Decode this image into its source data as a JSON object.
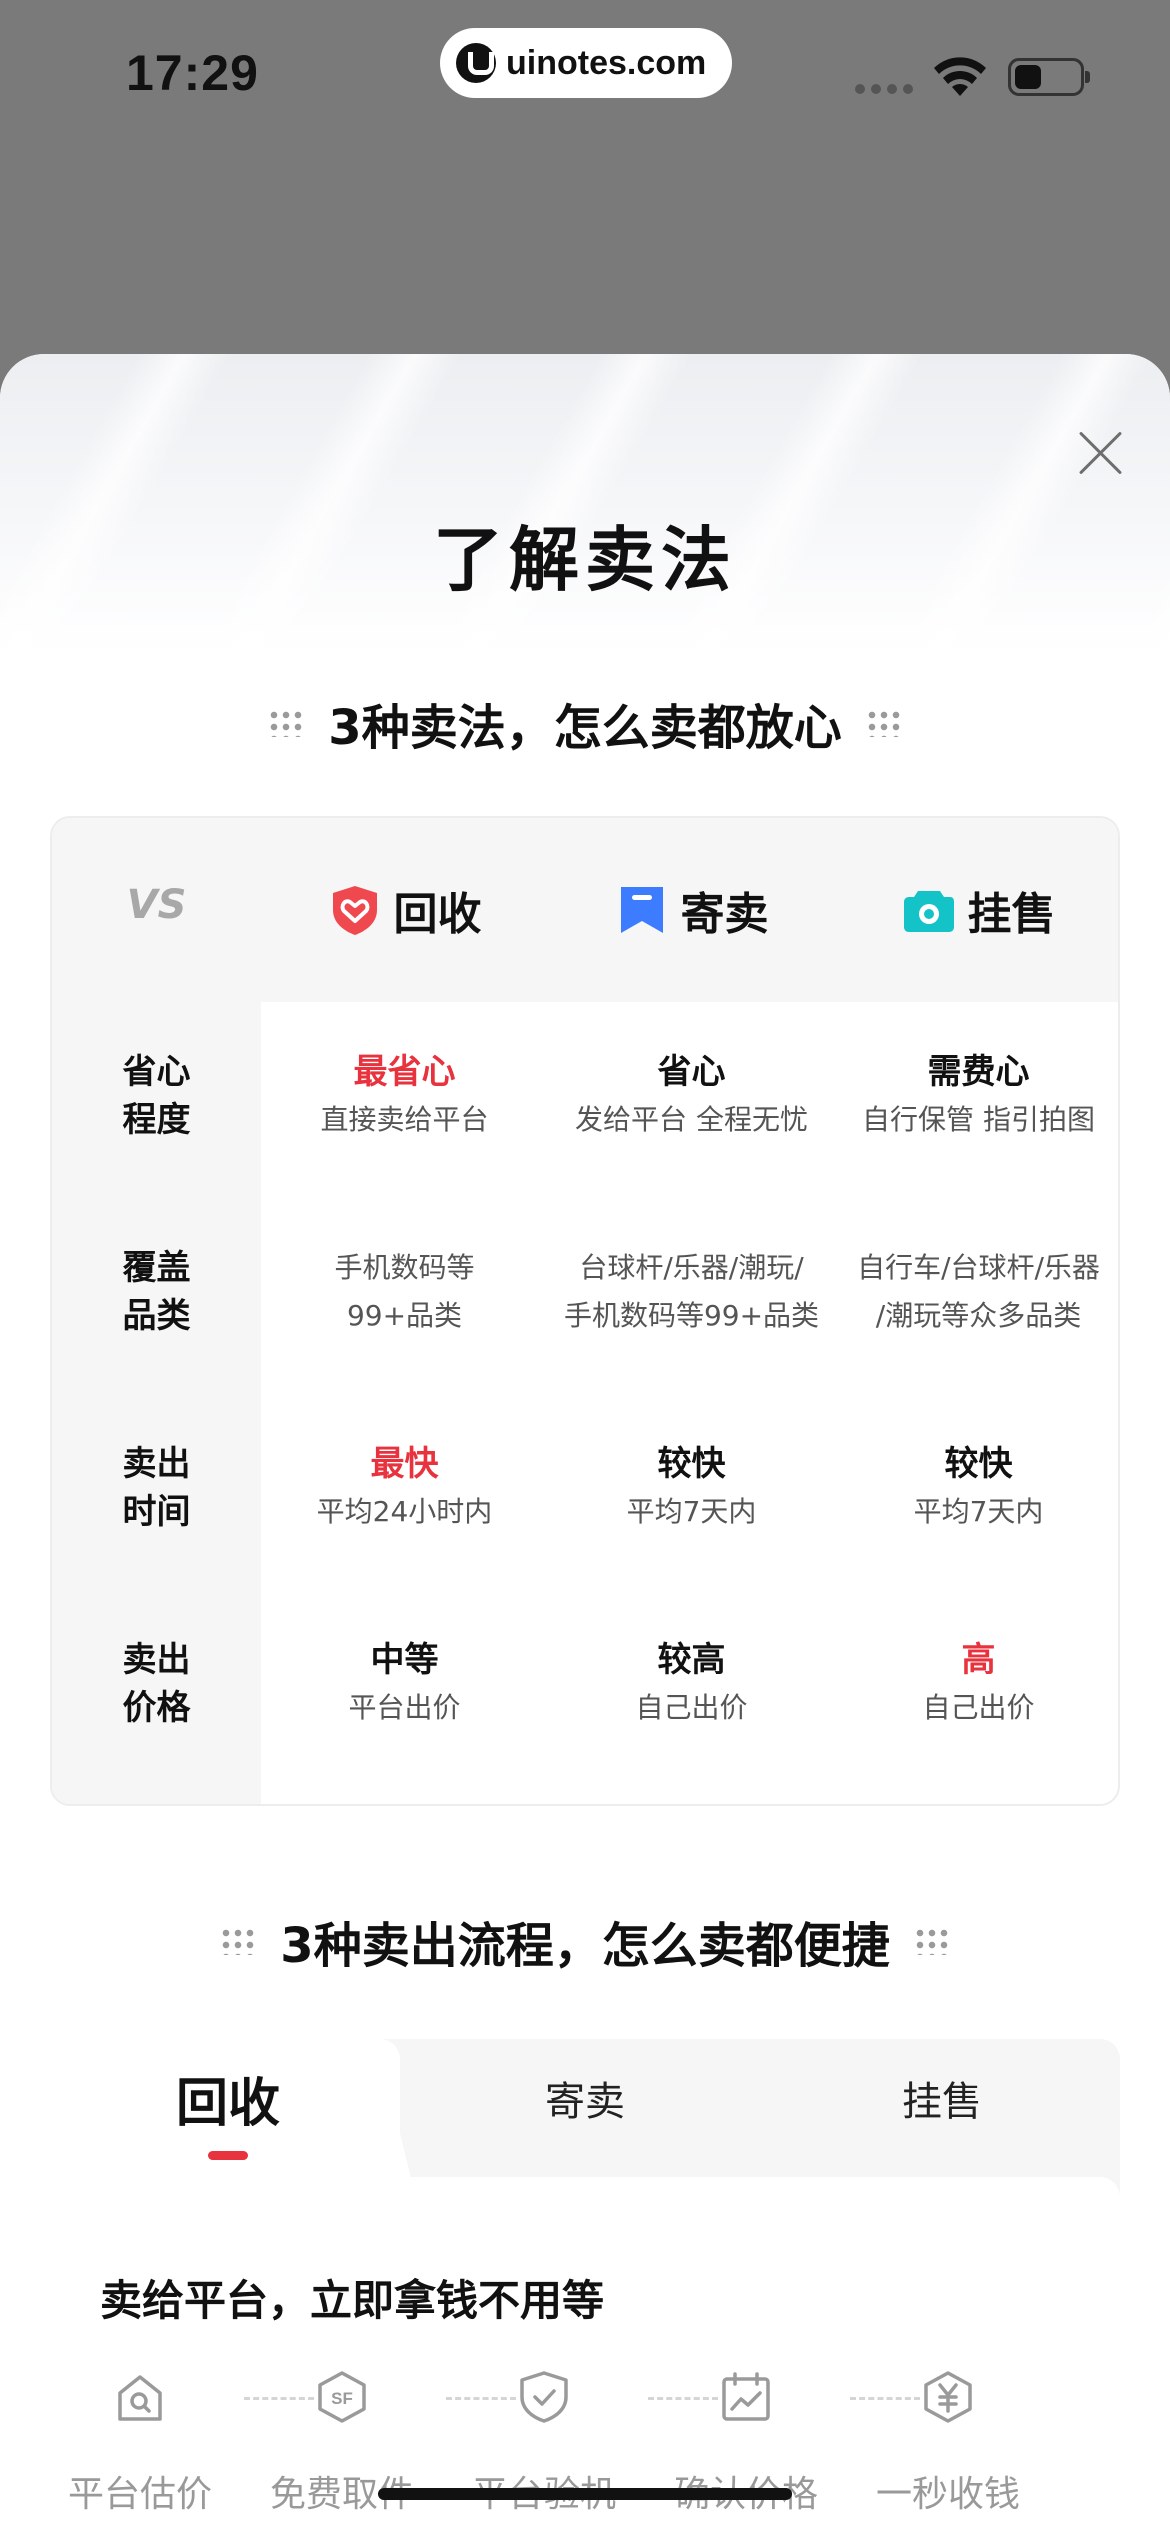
{
  "status_bar": {
    "time": "17:29",
    "watermark": "uinotes.com",
    "icons": [
      "signal-dots-icon",
      "wifi-icon",
      "battery-icon"
    ]
  },
  "sheet": {
    "title": "了解卖法",
    "close_icon": "close-icon"
  },
  "compare": {
    "heading": "3种卖法，怎么卖都放心",
    "vs": "VS",
    "columns": [
      {
        "label": "回收",
        "icon": "shield-heart-icon",
        "color": "#f0484f"
      },
      {
        "label": "寄卖",
        "icon": "bookmark-icon",
        "color": "#3d7bff"
      },
      {
        "label": "挂售",
        "icon": "camera-icon",
        "color": "#14c3c7"
      }
    ],
    "rows": [
      {
        "label_line1": "省心",
        "label_line2": "程度",
        "cells": [
          {
            "main": "最省心",
            "sub": "直接卖给平台",
            "highlight": true
          },
          {
            "main": "省心",
            "sub": "发给平台 全程无忧",
            "highlight": false
          },
          {
            "main": "需费心",
            "sub": "自行保管 指引拍图",
            "highlight": false
          }
        ]
      },
      {
        "label_line1": "覆盖",
        "label_line2": "品类",
        "cells": [
          {
            "line1": "手机数码等",
            "line2": "99+品类"
          },
          {
            "line1": "台球杆/乐器/潮玩/",
            "line2": "手机数码等99+品类"
          },
          {
            "line1": "自行车/台球杆/乐器",
            "line2": "/潮玩等众多品类"
          }
        ]
      },
      {
        "label_line1": "卖出",
        "label_line2": "时间",
        "cells": [
          {
            "main": "最快",
            "sub": "平均24小时内",
            "highlight": true
          },
          {
            "main": "较快",
            "sub": "平均7天内",
            "highlight": false
          },
          {
            "main": "较快",
            "sub": "平均7天内",
            "highlight": false
          }
        ]
      },
      {
        "label_line1": "卖出",
        "label_line2": "价格",
        "cells": [
          {
            "main": "中等",
            "sub": "平台出价",
            "highlight": false
          },
          {
            "main": "较高",
            "sub": "自己出价",
            "highlight": false
          },
          {
            "main": "高",
            "sub": "自己出价",
            "highlight": true
          }
        ]
      }
    ]
  },
  "process": {
    "heading": "3种卖出流程，怎么卖都便捷",
    "tabs": [
      "回收",
      "寄卖",
      "挂售"
    ],
    "active_tab": "回收",
    "description": "卖给平台，立即拿钱不用等",
    "steps": [
      {
        "label": "平台估价",
        "icon": "house-search-icon"
      },
      {
        "label": "免费取件",
        "icon": "sf-express-icon"
      },
      {
        "label": "平台验机",
        "icon": "inspect-shield-icon"
      },
      {
        "label": "确认价格",
        "icon": "calendar-chart-icon"
      },
      {
        "label": "一秒收钱",
        "icon": "yuan-coin-icon"
      }
    ]
  },
  "colors": {
    "accent_red": "#e8323e",
    "backdrop": "#7a7a7a"
  }
}
